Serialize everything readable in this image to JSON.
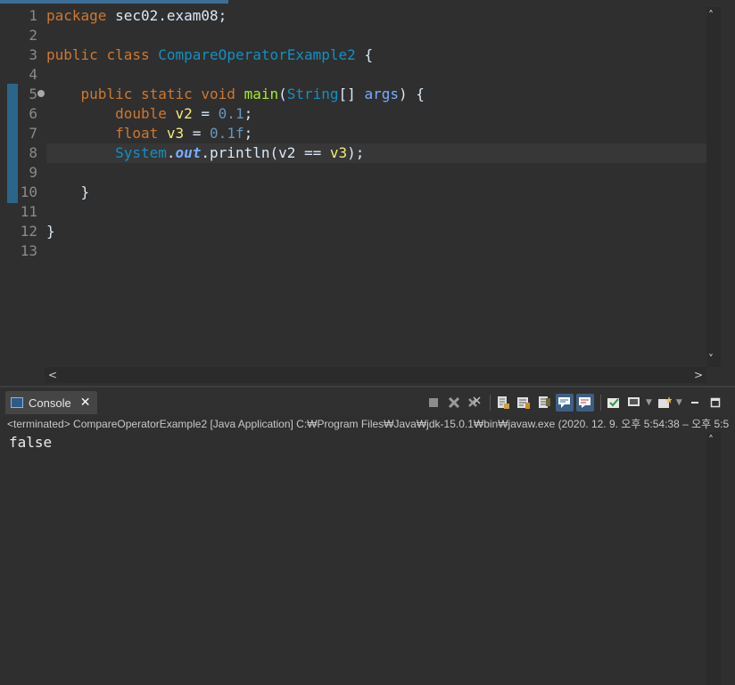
{
  "editor": {
    "line_numbers": [
      "1",
      "2",
      "3",
      "4",
      "5",
      "6",
      "7",
      "8",
      "9",
      "10",
      "11",
      "12",
      "13"
    ],
    "lines": [
      [
        {
          "t": "package",
          "c": "kw"
        },
        {
          "t": " sec02.exam08;",
          "c": "plain"
        }
      ],
      [],
      [
        {
          "t": "public",
          "c": "kw"
        },
        {
          "t": " ",
          "c": "plain"
        },
        {
          "t": "class",
          "c": "kw"
        },
        {
          "t": " ",
          "c": "plain"
        },
        {
          "t": "CompareOperatorExample2",
          "c": "type"
        },
        {
          "t": " {",
          "c": "plain"
        }
      ],
      [],
      [
        {
          "t": "    ",
          "c": "plain"
        },
        {
          "t": "public",
          "c": "kw"
        },
        {
          "t": " ",
          "c": "plain"
        },
        {
          "t": "static",
          "c": "kw"
        },
        {
          "t": " ",
          "c": "plain"
        },
        {
          "t": "void",
          "c": "kw"
        },
        {
          "t": " ",
          "c": "plain"
        },
        {
          "t": "main",
          "c": "method"
        },
        {
          "t": "(",
          "c": "plain"
        },
        {
          "t": "String",
          "c": "type"
        },
        {
          "t": "[] ",
          "c": "plain"
        },
        {
          "t": "args",
          "c": "param"
        },
        {
          "t": ") {",
          "c": "plain"
        }
      ],
      [
        {
          "t": "        ",
          "c": "plain"
        },
        {
          "t": "double",
          "c": "kw"
        },
        {
          "t": " ",
          "c": "plain"
        },
        {
          "t": "v2",
          "c": "var"
        },
        {
          "t": " = ",
          "c": "plain"
        },
        {
          "t": "0.1",
          "c": "num"
        },
        {
          "t": ";",
          "c": "plain"
        }
      ],
      [
        {
          "t": "        ",
          "c": "plain"
        },
        {
          "t": "float",
          "c": "kw"
        },
        {
          "t": " ",
          "c": "plain"
        },
        {
          "t": "v3",
          "c": "var"
        },
        {
          "t": " = ",
          "c": "plain"
        },
        {
          "t": "0.1f",
          "c": "num"
        },
        {
          "t": ";",
          "c": "plain"
        }
      ],
      [
        {
          "t": "        ",
          "c": "plain"
        },
        {
          "t": "System",
          "c": "type"
        },
        {
          "t": ".",
          "c": "plain"
        },
        {
          "t": "out",
          "c": "field"
        },
        {
          "t": ".println(",
          "c": "plain"
        },
        {
          "t": "v2",
          "c": "plain"
        },
        {
          "t": " == ",
          "c": "plain"
        },
        {
          "t": "v3",
          "c": "var"
        },
        {
          "t": ");",
          "c": "plain"
        }
      ],
      [],
      [
        {
          "t": "    }",
          "c": "plain"
        }
      ],
      [],
      [
        {
          "t": "}",
          "c": "plain"
        }
      ],
      []
    ],
    "current_line": 8,
    "scroll": {
      "up": "˄",
      "down": "˅",
      "left": "<",
      "right": ">"
    }
  },
  "console": {
    "tab_label": "Console",
    "tab_close": "✕",
    "toolbar_icons": [
      "terminate-icon",
      "remove-launch-icon",
      "remove-all-launches-icon",
      "scroll-lock-icon",
      "word-wrap-icon",
      "show-console-on-output-icon",
      "show-console-on-error-icon",
      "pin-console-icon",
      "display-selected-console-icon",
      "open-console-icon",
      "minimize-icon",
      "maximize-icon"
    ],
    "status": "<terminated> CompareOperatorExample2 [Java Application] C:₩Program Files₩Java₩jdk-15.0.1₩bin₩javaw.exe  (2020. 12. 9. 오후 5:54:38 – 오후 5:5",
    "output": "false",
    "scroll_up": "˄"
  },
  "colors": {
    "background": "#2f2f2f",
    "keyword": "#cc7832",
    "type": "#1290c3",
    "method": "#a7ec21",
    "variable": "#f3ec79",
    "number": "#6897bb",
    "accent": "#3c6e96"
  }
}
